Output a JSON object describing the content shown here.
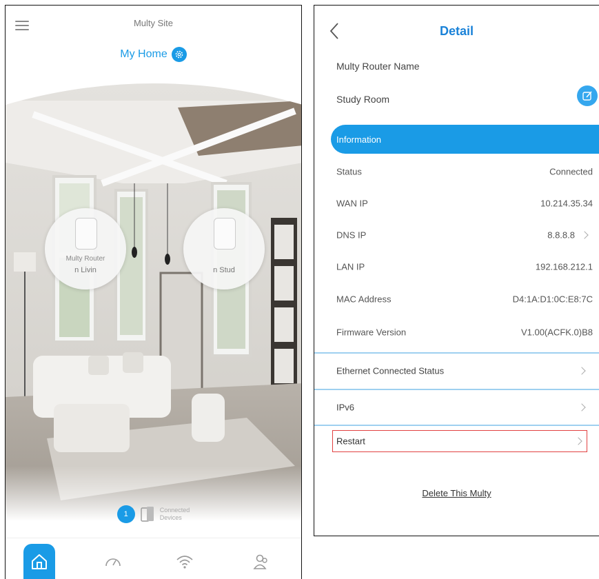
{
  "left": {
    "site_title": "Multy Site",
    "home_name": "My Home",
    "routers": [
      {
        "label1": "Multy Router",
        "label2": "n   Livin"
      },
      {
        "label1": "",
        "label2": "n   Stud"
      }
    ],
    "connected": {
      "count": "1",
      "label_line1": "Connected",
      "label_line2": "Devices"
    },
    "nav": [
      "home",
      "speed",
      "wifi",
      "users"
    ]
  },
  "right": {
    "title": "Detail",
    "router_name_label": "Multy Router Name",
    "router_name_value": "Study Room",
    "info_header": "Information",
    "info_rows": [
      {
        "label": "Status",
        "value": "Connected"
      },
      {
        "label": "WAN IP",
        "value": "10.214.35.34"
      },
      {
        "label": "DNS IP",
        "value": "8.8.8.8"
      },
      {
        "label": "LAN IP",
        "value": "192.168.212.1"
      },
      {
        "label": "MAC Address",
        "value": "D4:1A:D1:0C:E8:7C"
      },
      {
        "label": "Firmware Version",
        "value": "V1.00(ACFK.0)B8"
      }
    ],
    "sections": [
      {
        "label": "Ethernet Connected Status"
      },
      {
        "label": "IPv6"
      }
    ],
    "restart_label": "Restart",
    "delete_label": "Delete This Multy"
  },
  "colors": {
    "accent": "#1a9be6",
    "title_blue": "#1a82d8",
    "highlight_red": "#e14040"
  }
}
